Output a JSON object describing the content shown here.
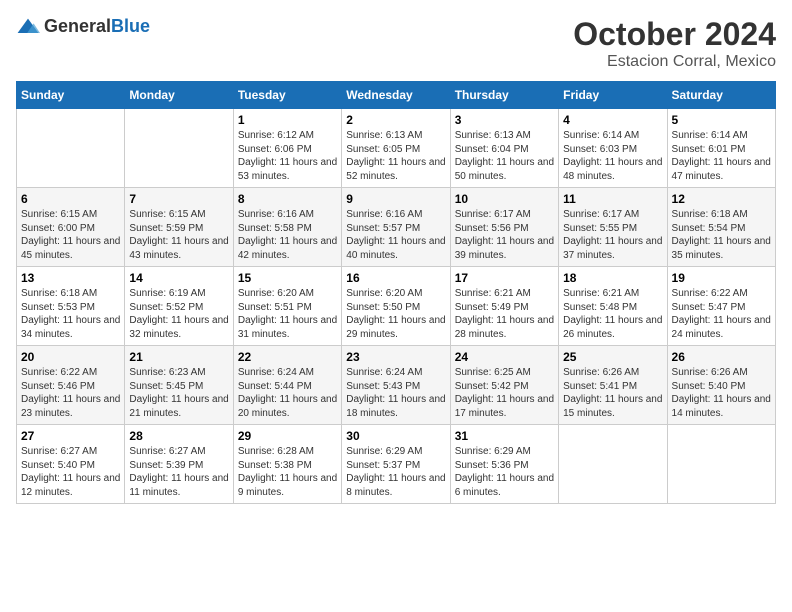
{
  "logo": {
    "general": "General",
    "blue": "Blue"
  },
  "title": "October 2024",
  "location": "Estacion Corral, Mexico",
  "days_of_week": [
    "Sunday",
    "Monday",
    "Tuesday",
    "Wednesday",
    "Thursday",
    "Friday",
    "Saturday"
  ],
  "weeks": [
    [
      {
        "day": "",
        "info": ""
      },
      {
        "day": "",
        "info": ""
      },
      {
        "day": "1",
        "info": "Sunrise: 6:12 AM\nSunset: 6:06 PM\nDaylight: 11 hours and 53 minutes."
      },
      {
        "day": "2",
        "info": "Sunrise: 6:13 AM\nSunset: 6:05 PM\nDaylight: 11 hours and 52 minutes."
      },
      {
        "day": "3",
        "info": "Sunrise: 6:13 AM\nSunset: 6:04 PM\nDaylight: 11 hours and 50 minutes."
      },
      {
        "day": "4",
        "info": "Sunrise: 6:14 AM\nSunset: 6:03 PM\nDaylight: 11 hours and 48 minutes."
      },
      {
        "day": "5",
        "info": "Sunrise: 6:14 AM\nSunset: 6:01 PM\nDaylight: 11 hours and 47 minutes."
      }
    ],
    [
      {
        "day": "6",
        "info": "Sunrise: 6:15 AM\nSunset: 6:00 PM\nDaylight: 11 hours and 45 minutes."
      },
      {
        "day": "7",
        "info": "Sunrise: 6:15 AM\nSunset: 5:59 PM\nDaylight: 11 hours and 43 minutes."
      },
      {
        "day": "8",
        "info": "Sunrise: 6:16 AM\nSunset: 5:58 PM\nDaylight: 11 hours and 42 minutes."
      },
      {
        "day": "9",
        "info": "Sunrise: 6:16 AM\nSunset: 5:57 PM\nDaylight: 11 hours and 40 minutes."
      },
      {
        "day": "10",
        "info": "Sunrise: 6:17 AM\nSunset: 5:56 PM\nDaylight: 11 hours and 39 minutes."
      },
      {
        "day": "11",
        "info": "Sunrise: 6:17 AM\nSunset: 5:55 PM\nDaylight: 11 hours and 37 minutes."
      },
      {
        "day": "12",
        "info": "Sunrise: 6:18 AM\nSunset: 5:54 PM\nDaylight: 11 hours and 35 minutes."
      }
    ],
    [
      {
        "day": "13",
        "info": "Sunrise: 6:18 AM\nSunset: 5:53 PM\nDaylight: 11 hours and 34 minutes."
      },
      {
        "day": "14",
        "info": "Sunrise: 6:19 AM\nSunset: 5:52 PM\nDaylight: 11 hours and 32 minutes."
      },
      {
        "day": "15",
        "info": "Sunrise: 6:20 AM\nSunset: 5:51 PM\nDaylight: 11 hours and 31 minutes."
      },
      {
        "day": "16",
        "info": "Sunrise: 6:20 AM\nSunset: 5:50 PM\nDaylight: 11 hours and 29 minutes."
      },
      {
        "day": "17",
        "info": "Sunrise: 6:21 AM\nSunset: 5:49 PM\nDaylight: 11 hours and 28 minutes."
      },
      {
        "day": "18",
        "info": "Sunrise: 6:21 AM\nSunset: 5:48 PM\nDaylight: 11 hours and 26 minutes."
      },
      {
        "day": "19",
        "info": "Sunrise: 6:22 AM\nSunset: 5:47 PM\nDaylight: 11 hours and 24 minutes."
      }
    ],
    [
      {
        "day": "20",
        "info": "Sunrise: 6:22 AM\nSunset: 5:46 PM\nDaylight: 11 hours and 23 minutes."
      },
      {
        "day": "21",
        "info": "Sunrise: 6:23 AM\nSunset: 5:45 PM\nDaylight: 11 hours and 21 minutes."
      },
      {
        "day": "22",
        "info": "Sunrise: 6:24 AM\nSunset: 5:44 PM\nDaylight: 11 hours and 20 minutes."
      },
      {
        "day": "23",
        "info": "Sunrise: 6:24 AM\nSunset: 5:43 PM\nDaylight: 11 hours and 18 minutes."
      },
      {
        "day": "24",
        "info": "Sunrise: 6:25 AM\nSunset: 5:42 PM\nDaylight: 11 hours and 17 minutes."
      },
      {
        "day": "25",
        "info": "Sunrise: 6:26 AM\nSunset: 5:41 PM\nDaylight: 11 hours and 15 minutes."
      },
      {
        "day": "26",
        "info": "Sunrise: 6:26 AM\nSunset: 5:40 PM\nDaylight: 11 hours and 14 minutes."
      }
    ],
    [
      {
        "day": "27",
        "info": "Sunrise: 6:27 AM\nSunset: 5:40 PM\nDaylight: 11 hours and 12 minutes."
      },
      {
        "day": "28",
        "info": "Sunrise: 6:27 AM\nSunset: 5:39 PM\nDaylight: 11 hours and 11 minutes."
      },
      {
        "day": "29",
        "info": "Sunrise: 6:28 AM\nSunset: 5:38 PM\nDaylight: 11 hours and 9 minutes."
      },
      {
        "day": "30",
        "info": "Sunrise: 6:29 AM\nSunset: 5:37 PM\nDaylight: 11 hours and 8 minutes."
      },
      {
        "day": "31",
        "info": "Sunrise: 6:29 AM\nSunset: 5:36 PM\nDaylight: 11 hours and 6 minutes."
      },
      {
        "day": "",
        "info": ""
      },
      {
        "day": "",
        "info": ""
      }
    ]
  ]
}
